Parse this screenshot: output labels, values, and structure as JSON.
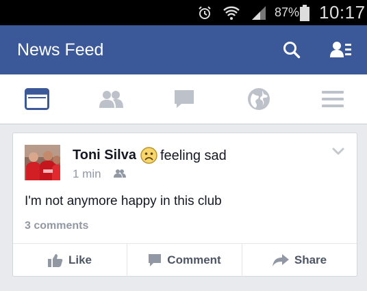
{
  "status_bar": {
    "battery_percent": "87%",
    "time": "10:17",
    "icons": [
      "alarm-icon",
      "wifi-icon",
      "signal-icon",
      "battery-icon"
    ]
  },
  "header": {
    "title": "News Feed",
    "icons": [
      "search-icon",
      "friend-requests-icon"
    ]
  },
  "tabs": [
    {
      "name": "news-feed",
      "icon": "news-feed-icon",
      "active": true
    },
    {
      "name": "friends",
      "icon": "friends-icon",
      "active": false
    },
    {
      "name": "messages",
      "icon": "messages-icon",
      "active": false
    },
    {
      "name": "notifications",
      "icon": "globe-icon",
      "active": false
    },
    {
      "name": "more",
      "icon": "menu-icon",
      "active": false
    }
  ],
  "post": {
    "author": "Toni Silva",
    "feeling_icon": "sad-face-icon",
    "feeling": "feeling sad",
    "time": "1 min",
    "audience_icon": "friends-audience-icon",
    "text": "I'm not anymore happy in this club",
    "comments": "3 comments",
    "actions": {
      "like": "Like",
      "comment": "Comment",
      "share": "Share"
    }
  },
  "colors": {
    "brand": "#3b5998",
    "background": "#e9eaed",
    "muted_text": "#9197a3",
    "action_text": "#4e5665"
  }
}
